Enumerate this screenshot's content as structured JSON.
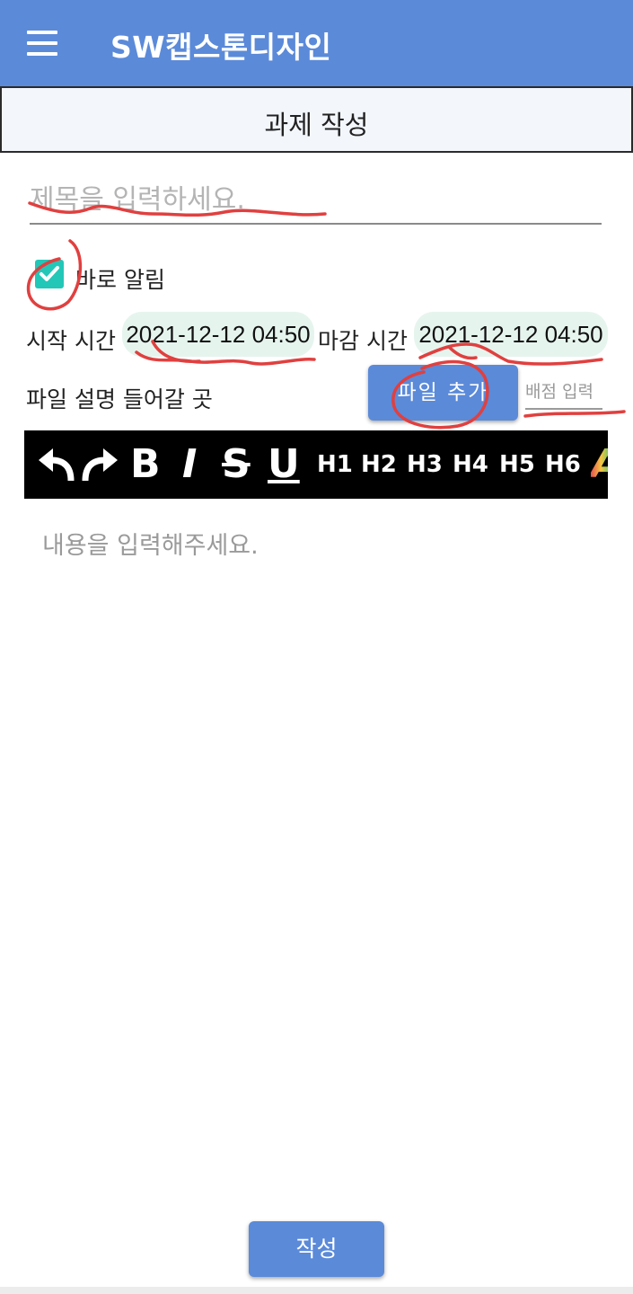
{
  "app_bar": {
    "title": "SW캡스톤디자인",
    "menu_icon": "hamburger-menu-icon",
    "color": "#5b8ad9"
  },
  "page_header": {
    "title": "과제 작성"
  },
  "form": {
    "title_placeholder": "제목을 입력하세요.",
    "notify_checkbox": {
      "checked": true,
      "label": "바로 알림",
      "color": "#22c7b8"
    },
    "start_time": {
      "label": "시작 시간",
      "value": "2021-12-12 04:50"
    },
    "end_time": {
      "label": "마감 시간",
      "value": "2021-12-12 04:50"
    },
    "file_description": "파일 설명 들어갈 곳",
    "file_button": "파일 추가",
    "score_placeholder": "배점 입력"
  },
  "toolbar": {
    "items": [
      {
        "name": "undo-icon"
      },
      {
        "name": "redo-icon"
      },
      {
        "name": "bold-icon",
        "label": "B"
      },
      {
        "name": "italic-icon",
        "label": "I"
      },
      {
        "name": "strikethrough-icon",
        "label": "S"
      },
      {
        "name": "underline-icon",
        "label": "U"
      },
      {
        "name": "heading-1",
        "label": "H1"
      },
      {
        "name": "heading-2",
        "label": "H2"
      },
      {
        "name": "heading-3",
        "label": "H3"
      },
      {
        "name": "heading-4",
        "label": "H4"
      },
      {
        "name": "heading-5",
        "label": "H5"
      },
      {
        "name": "heading-6",
        "label": "H6"
      },
      {
        "name": "text-color-icon",
        "label": "A"
      }
    ]
  },
  "editor": {
    "placeholder": "내용을 입력해주세요."
  },
  "submit_button": "작성"
}
